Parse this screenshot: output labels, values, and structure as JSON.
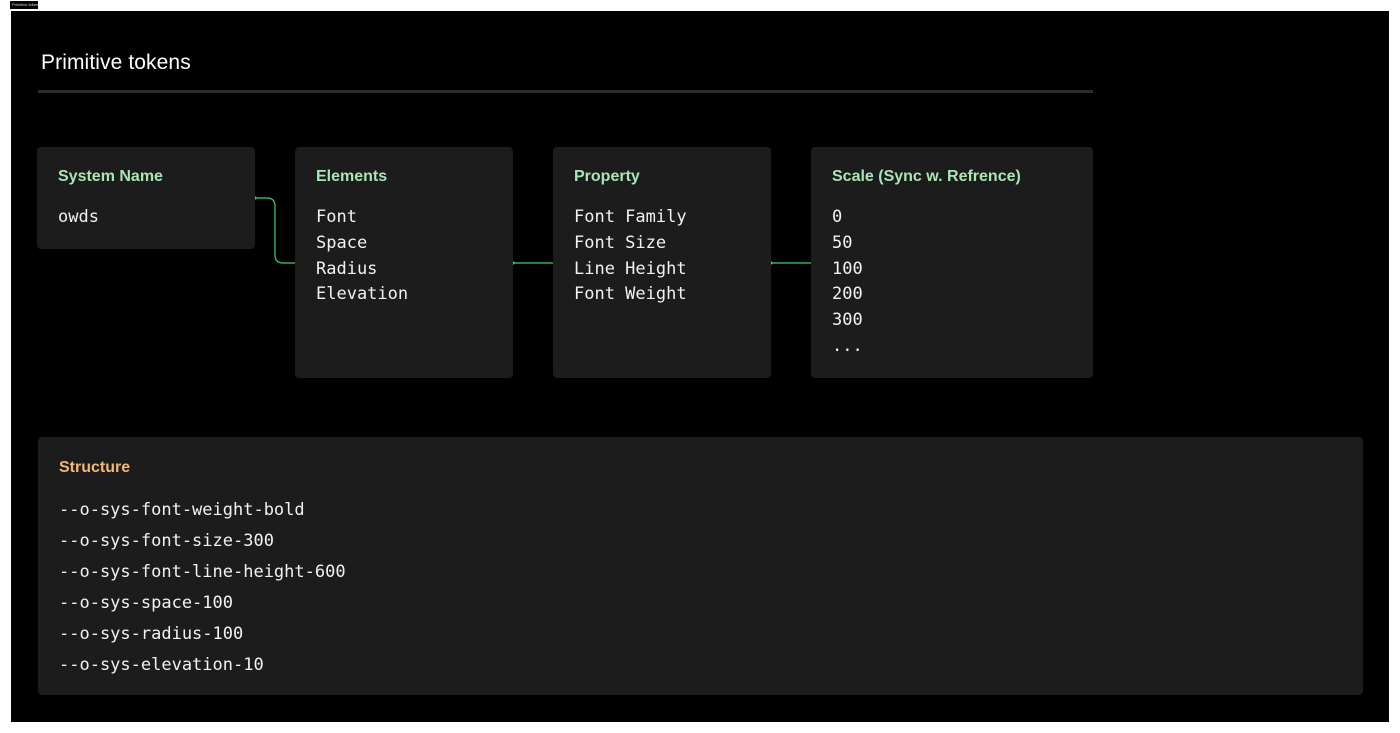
{
  "frame_label": "Primitive tokens",
  "page_title": "Primitive tokens",
  "colors": {
    "heading_green": "#a8e6b4",
    "heading_orange": "#f5b86a",
    "connector": "#3ecf6e",
    "card_bg": "#1c1c1c"
  },
  "cards": [
    {
      "heading": "System Name",
      "items": [
        "owds"
      ]
    },
    {
      "heading": "Elements",
      "items": [
        "Font",
        "Space",
        "Radius",
        "Elevation"
      ]
    },
    {
      "heading": "Property",
      "items": [
        "Font Family",
        "Font Size",
        "Line Height",
        "Font Weight"
      ]
    },
    {
      "heading": "Scale (Sync w. Refrence)",
      "items": [
        "0",
        "50",
        "100",
        "200",
        "300",
        "..."
      ]
    }
  ],
  "structure": {
    "heading": "Structure",
    "lines": [
      "--o-sys-font-weight-bold",
      "--o-sys-font-size-300",
      "--o-sys-font-line-height-600",
      "--o-sys-space-100",
      "--o-sys-radius-100",
      "--o-sys-elevation-10"
    ]
  }
}
